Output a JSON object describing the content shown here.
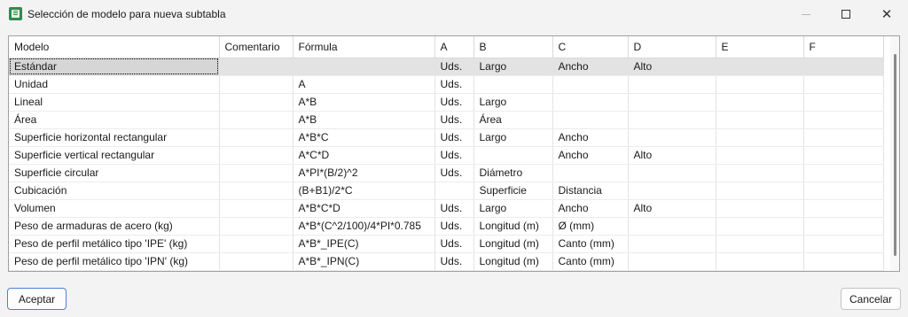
{
  "window": {
    "title": "Selección de modelo para nueva subtabla",
    "minimize": "—",
    "close": "✕"
  },
  "table": {
    "columns": [
      "Modelo",
      "Comentario",
      "Fórmula",
      "A",
      "B",
      "C",
      "D",
      "E",
      "F"
    ],
    "rows": [
      [
        "Estándar",
        "",
        "",
        "Uds.",
        "Largo",
        "Ancho",
        "Alto",
        "",
        ""
      ],
      [
        "Unidad",
        "",
        "A",
        "Uds.",
        "",
        "",
        "",
        "",
        ""
      ],
      [
        "Lineal",
        "",
        "A*B",
        "Uds.",
        "Largo",
        "",
        "",
        "",
        ""
      ],
      [
        "Área",
        "",
        "A*B",
        "Uds.",
        "Área",
        "",
        "",
        "",
        ""
      ],
      [
        "Superficie horizontal rectangular",
        "",
        "A*B*C",
        "Uds.",
        "Largo",
        "Ancho",
        "",
        "",
        ""
      ],
      [
        "Superficie vertical rectangular",
        "",
        "A*C*D",
        "Uds.",
        "",
        "Ancho",
        "Alto",
        "",
        ""
      ],
      [
        "Superficie circular",
        "",
        "A*PI*(B/2)^2",
        "Uds.",
        "Diámetro",
        "",
        "",
        "",
        ""
      ],
      [
        "Cubicación",
        "",
        "(B+B1)/2*C",
        "",
        "Superficie",
        "Distancia",
        "",
        "",
        ""
      ],
      [
        "Volumen",
        "",
        "A*B*C*D",
        "Uds.",
        "Largo",
        "Ancho",
        "Alto",
        "",
        ""
      ],
      [
        "Peso de armaduras de acero (kg)",
        "",
        "A*B*(C^2/100)/4*PI*0.785",
        "Uds.",
        "Longitud (m)",
        "Ø (mm)",
        "",
        "",
        ""
      ],
      [
        "Peso de perfil metálico tipo 'IPE' (kg)",
        "",
        "A*B*_IPE(C)",
        "Uds.",
        "Longitud (m)",
        "Canto (mm)",
        "",
        "",
        ""
      ],
      [
        "Peso de perfil metálico tipo 'IPN' (kg)",
        "",
        "A*B*_IPN(C)",
        "Uds.",
        "Longitud (m)",
        "Canto (mm)",
        "",
        "",
        ""
      ]
    ],
    "selected_row": 0
  },
  "buttons": {
    "ok": "Aceptar",
    "cancel": "Cancelar"
  }
}
